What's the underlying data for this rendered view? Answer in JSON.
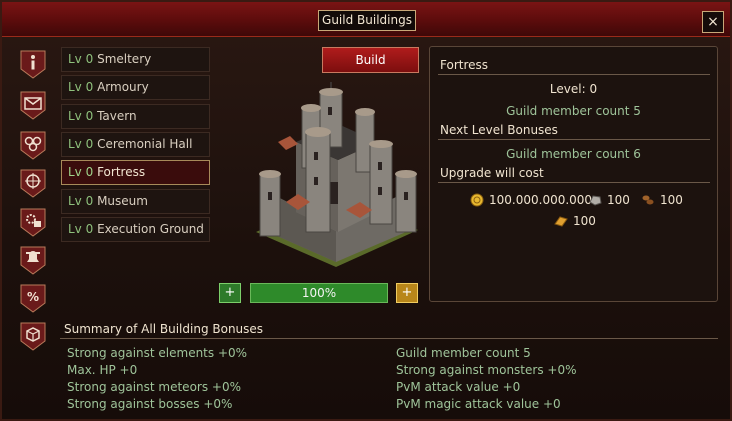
{
  "window": {
    "title": "Guild Buildings",
    "close_label": "×"
  },
  "side_icons": [
    "info-icon",
    "mail-icon",
    "guild-members-icon",
    "compass-icon",
    "gear-building-icon",
    "bell-shield-icon",
    "percent-icon",
    "crate-icon"
  ],
  "buildings": [
    {
      "level": "Lv 0",
      "name": "Smeltery"
    },
    {
      "level": "Lv 0",
      "name": "Armoury"
    },
    {
      "level": "Lv 0",
      "name": "Tavern"
    },
    {
      "level": "Lv 0",
      "name": "Ceremonial Hall"
    },
    {
      "level": "Lv 0",
      "name": "Fortress"
    },
    {
      "level": "Lv 0",
      "name": "Museum"
    },
    {
      "level": "Lv 0",
      "name": "Execution Ground"
    }
  ],
  "selected_building": "Fortress",
  "actions": {
    "build_label": "Build",
    "minus_label": "+",
    "plus_label": "+"
  },
  "progress": {
    "label": "100%",
    "value": 1.0
  },
  "details": {
    "name": "Fortress",
    "level_text": "Level: 0",
    "current_bonus": "Guild member count 5",
    "next_heading": "Next Level Bonuses",
    "next_bonus": "Guild member count 6",
    "cost_heading": "Upgrade will cost",
    "costs": [
      {
        "icon": "gold-coin-icon",
        "amount": "100.000.000.000"
      },
      {
        "icon": "stone-icon",
        "amount": "100"
      },
      {
        "icon": "wood-icon",
        "amount": "100"
      },
      {
        "icon": "metal-icon",
        "amount": "100"
      }
    ]
  },
  "summary": {
    "title": "Summary of All Building Bonuses",
    "left": [
      "Strong against elements +0%",
      "Max. HP +0",
      "Strong against meteors +0%",
      "Strong against bosses +0%"
    ],
    "right": [
      "Guild member count 5",
      "Strong against monsters +0%",
      "PvM attack value +0",
      "PvM magic attack value +0"
    ]
  },
  "colors": {
    "accent_red": "#7a1414",
    "bonus_green": "#9fc49a",
    "level_green": "#8ec07c"
  }
}
